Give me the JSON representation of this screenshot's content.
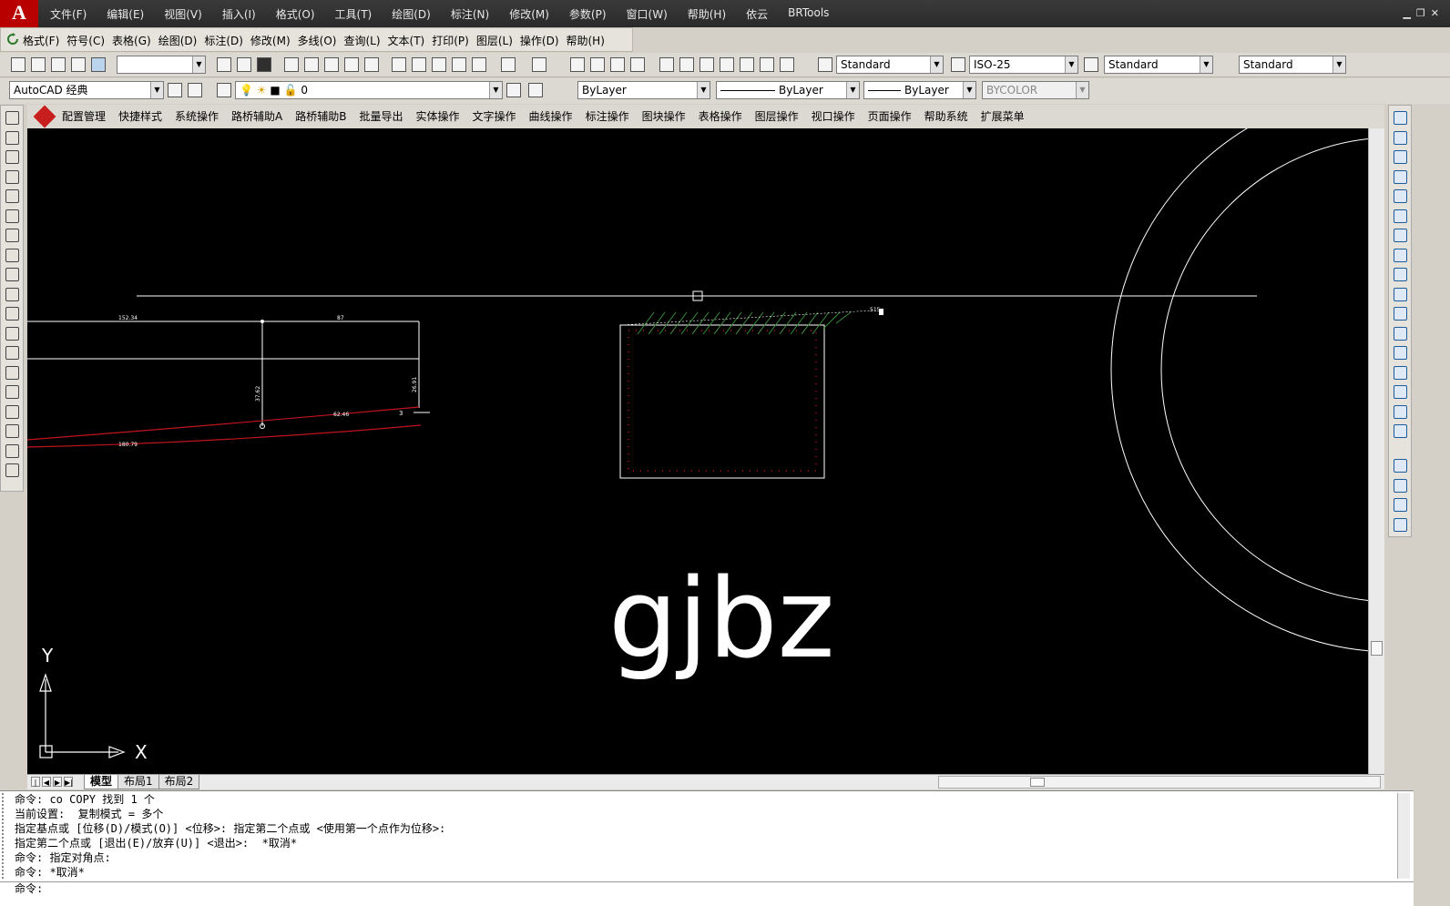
{
  "menubar": {
    "logo": "A",
    "items": [
      "文件(F)",
      "编辑(E)",
      "视图(V)",
      "插入(I)",
      "格式(O)",
      "工具(T)",
      "绘图(D)",
      "标注(N)",
      "修改(M)",
      "参数(P)",
      "窗口(W)",
      "帮助(H)",
      "依云",
      "BRTools"
    ]
  },
  "toolbar_custom": {
    "items": [
      "格式(F)",
      "符号(C)",
      "表格(G)",
      "绘图(D)",
      "标注(D)",
      "修改(M)",
      "多线(O)",
      "查询(L)",
      "文本(T)",
      "打印(P)",
      "图层(L)",
      "操作(D)",
      "帮助(H)"
    ]
  },
  "styles": {
    "text_style": "Standard",
    "dim_style": "ISO-25",
    "table_style": "Standard",
    "multileader_style": "Standard"
  },
  "workspace": "AutoCAD 经典",
  "layer": {
    "current": "0"
  },
  "properties": {
    "color": "ByLayer",
    "linetype": "ByLayer",
    "lineweight": "ByLayer",
    "plotstyle": "BYCOLOR"
  },
  "plugin_menu": {
    "items": [
      "配置管理",
      "快捷样式",
      "系统操作",
      "路桥辅助A",
      "路桥辅助B",
      "批量导出",
      "实体操作",
      "文字操作",
      "曲线操作",
      "标注操作",
      "图块操作",
      "表格操作",
      "图层操作",
      "视口操作",
      "页面操作",
      "帮助系统",
      "扩展菜单"
    ]
  },
  "drawing": {
    "big_text": "gjbz",
    "dim_labels": [
      "152.34",
      "87",
      "37.62",
      "26.91",
      "62.46",
      "180.79",
      "515",
      "3"
    ],
    "ucs_x": "X",
    "ucs_y": "Y"
  },
  "layout_tabs": [
    "模型",
    "布局1",
    "布局2"
  ],
  "command_history": [
    "命令: co COPY 找到 1 个",
    "当前设置:  复制模式 = 多个",
    "指定基点或 [位移(D)/模式(O)] <位移>: 指定第二个点或 <使用第一个点作为位移>:",
    "指定第二个点或 [退出(E)/放弃(U)] <退出>:  *取消*",
    "命令: 指定对角点:",
    "命令: *取消*"
  ],
  "command_prompt": "命令:",
  "colors": {
    "canvas_bg": "#000000",
    "drawing_line": "#ffffff",
    "red_curve": "#c0141e",
    "hatch_green": "#3c8c3c",
    "toolbar_bg": "#dcd9d2"
  }
}
